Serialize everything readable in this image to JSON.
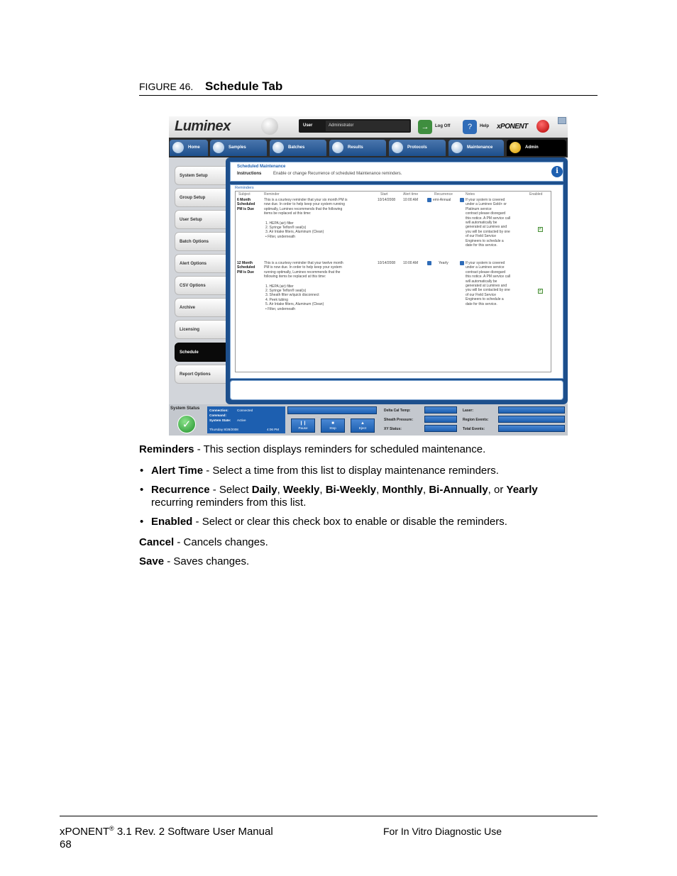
{
  "figure": {
    "number": "FIGURE 46.",
    "title": "Schedule Tab"
  },
  "app": {
    "logo": "Luminex",
    "user_label": "User",
    "user_value": "Administrator",
    "logoff": "Log Off",
    "help": "Help",
    "brand": "xPONENT",
    "tabs": [
      "Home",
      "Samples",
      "Batches",
      "Results",
      "Protocols",
      "Maintenance",
      "Admin"
    ],
    "sidebar": [
      "System Setup",
      "Group Setup",
      "User Setup",
      "Batch Options",
      "Alert Options",
      "CSV Options",
      "Archive",
      "Licensing",
      "Schedule",
      "Report Options"
    ],
    "section_title": "Scheduled Maintenance",
    "instructions_label": "Instructions",
    "instructions_text": "Enable or change Recurrence of scheduled Maintenance reminders.",
    "reminders_label": "Reminders",
    "columns": [
      "Subject",
      "Reminder",
      "Start",
      "Alert time",
      "Recurrence",
      "Notes",
      "Enabled"
    ],
    "rows": [
      {
        "subject": [
          "6 Month",
          "Scheduled",
          "PM is Due"
        ],
        "reminder": [
          "This is a courtesy reminder that your six month PM is",
          "now due. In order to help keep your system running",
          "optimally, Luminex recommends that the following",
          "items be replaced at this time:"
        ],
        "items": [
          "1.     HEPA (air) filter",
          "2.     Syringe Teflon® seal(s)",
          "3.     Air Intake filters, Aluminum (Clean)",
          "      • Filter, underneath"
        ],
        "start": "10/14/2008",
        "alert": "10:00 AM",
        "recurrence": "emi-Annual",
        "notes": [
          "If your system is covered",
          "under a Luminex Gold+ or",
          "Platinum service",
          "contract please disregard",
          "this notice. A PM service call",
          "will automatically be",
          "generated at Luminex and",
          "you will be contacted by one",
          "of our Field Service",
          "Engineers to schedule a",
          "date for this service."
        ],
        "enabled": true
      },
      {
        "subject": [
          "12 Month",
          "Scheduled",
          "PM is Due"
        ],
        "reminder": [
          "This is a courtesy reminder that your twelve month",
          "PM is now due. In order to help keep your system",
          "running optimally, Luminex recommends that the",
          "following items be replaced at this time:"
        ],
        "items": [
          "1.     HEPA (air) filter",
          "2.     Syringe Teflon® seal(s)",
          "3.     Sheath filter w/quick disconnect",
          "4.     Peek tubing",
          "5.     Air Intake filters, Aluminum (Clean)",
          "      • Filter, underneath"
        ],
        "start": "10/14/2008",
        "alert": "10:00 AM",
        "recurrence": "Yearly",
        "notes": [
          "If your system is covered",
          "under a Luminex service",
          "contract please disregard",
          "this notice. A PM service call",
          "will automatically be",
          "generated at Luminex and",
          "you will be contacted by one",
          "of our Field Service",
          "Engineers to schedule a",
          "date for this service."
        ],
        "enabled": true
      }
    ],
    "status": {
      "label": "System Status",
      "connection_label": "Connection:",
      "connection_value": "Connected",
      "command_label": "Command:",
      "state_label": "System State:",
      "state_value": "Active",
      "datetime": "Thursday 8/28/2008",
      "time": "4:06 PM",
      "buttons": [
        "Pause",
        "Stop",
        "Eject"
      ],
      "metrics": [
        "Delta Cal Temp:",
        "Sheath Pressure:",
        "XY Status:",
        "Laser:",
        "Region Events:",
        "Total Events:"
      ]
    }
  },
  "body": {
    "reminders_term": "Reminders",
    "reminders_desc": " - This section displays reminders for scheduled maintenance.",
    "alert_term": "Alert Time",
    "alert_desc": " - Select a time from this list to display maintenance reminders.",
    "recurrence_term": "Recurrence",
    "recurrence_pre": " - Select ",
    "opt_daily": "Daily",
    "opt_weekly": "Weekly",
    "opt_biweekly": "Bi-Weekly",
    "opt_monthly": "Monthly",
    "opt_biannually": "Bi-Annually",
    "opt_yearly": "Yearly",
    "sep": ", ",
    "or": ", or ",
    "recurrence_post": "recurring reminders from this list.",
    "enabled_term": "Enabled",
    "enabled_desc": " - Select or clear this check box to enable or disable the reminders.",
    "cancel_term": "Cancel",
    "cancel_desc": " - Cancels changes.",
    "save_term": "Save",
    "save_desc": " - Saves changes."
  },
  "footer": {
    "manual_prefix": "xPONENT",
    "reg": "®",
    "manual_suffix": " 3.1 Rev. 2 Software User Manual",
    "page_number": "68",
    "usage": "For In Vitro Diagnostic Use"
  }
}
